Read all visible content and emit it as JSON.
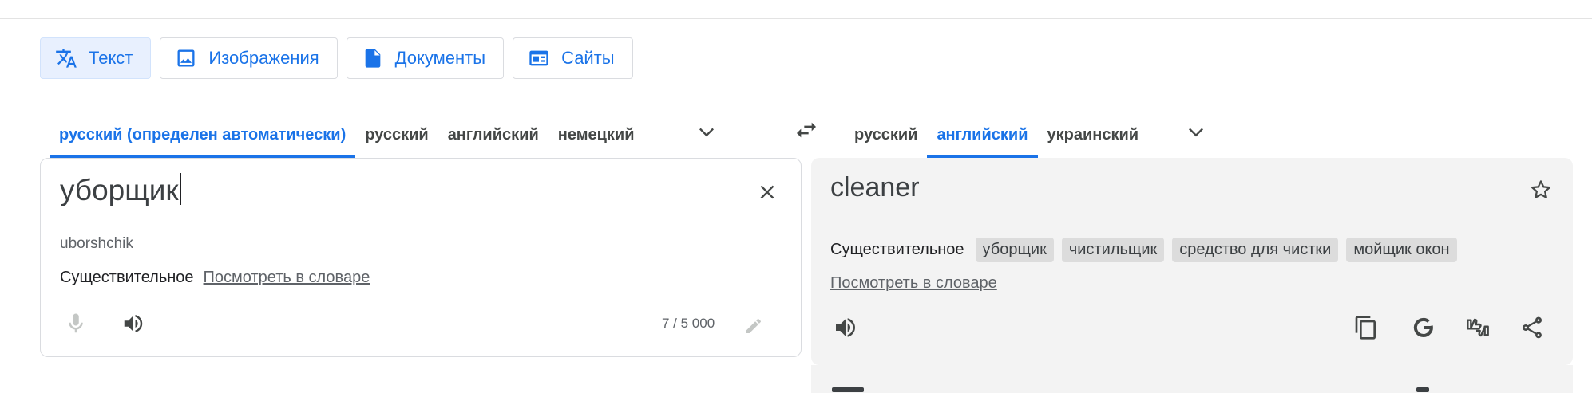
{
  "modes": [
    {
      "label": "Текст",
      "icon": "translate-icon",
      "active": true
    },
    {
      "label": "Изображения",
      "icon": "image-icon"
    },
    {
      "label": "Документы",
      "icon": "document-icon"
    },
    {
      "label": "Сайты",
      "icon": "website-icon"
    }
  ],
  "source_langs": [
    {
      "label": "русский (определен автоматически)",
      "active": true
    },
    {
      "label": "русский"
    },
    {
      "label": "английский"
    },
    {
      "label": "немецкий"
    }
  ],
  "target_langs": [
    {
      "label": "русский"
    },
    {
      "label": "английский",
      "active": true
    },
    {
      "label": "украинский"
    }
  ],
  "source": {
    "text": "уборщик",
    "transliteration": "uborshchik",
    "pos": "Существительное",
    "dict_link": "Посмотреть в словаре",
    "counter": "7 / 5 000"
  },
  "target": {
    "text": "cleaner",
    "pos": "Существительное",
    "alternatives": [
      "уборщик",
      "чистильщик",
      "средство для чистки",
      "мойщик окон"
    ],
    "dict_link": "Посмотреть в словаре"
  },
  "colors": {
    "accent": "#1a73e8",
    "panel_bg": "#f3f3f3",
    "border": "#dadce0"
  }
}
